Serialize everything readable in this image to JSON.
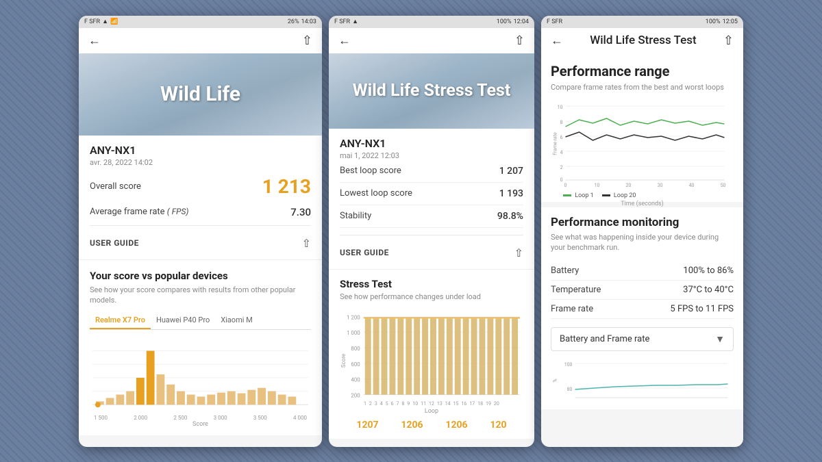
{
  "phone1": {
    "statusBar": {
      "carrier": "F SFR",
      "signal": "▲▼",
      "wifi": "▾",
      "battery": "26%",
      "time": "14:03"
    },
    "hero": {
      "title": "Wild Life"
    },
    "result": {
      "deviceName": "ANY-NX1",
      "date": "avr. 28, 2022 14:02",
      "overallScoreLabel": "Overall score",
      "overallScore": "1 213",
      "avgFrameLabel": "Average frame rate (FPS)",
      "avgFrameValue": "7.30",
      "userGuide": "USER GUIDE"
    },
    "compare": {
      "title": "Your score vs popular devices",
      "subtitle": "See how your score compares with results from other popular models.",
      "tabs": [
        "Realme X7 Pro",
        "Huawei P40 Pro",
        "Xiaomi M"
      ],
      "activeTab": 0
    },
    "xAxisLabels": [
      "1 500",
      "2 000",
      "2 500",
      "3 000",
      "3 500",
      "4 000"
    ],
    "xAxisTitle": "Score"
  },
  "phone2": {
    "statusBar": {
      "carrier": "F SFR",
      "signal": "▲▼",
      "wifi": "▾",
      "battery": "100%",
      "time": "12:04"
    },
    "hero": {
      "title": "Wild Life Stress Test"
    },
    "result": {
      "deviceName": "ANY-NX1",
      "date": "mai 1, 2022 12:03",
      "bestLoopLabel": "Best loop score",
      "bestLoopValue": "1 207",
      "lowestLoopLabel": "Lowest loop score",
      "lowestLoopValue": "1 193",
      "stabilityLabel": "Stability",
      "stabilityValue": "98.8%",
      "userGuide": "USER GUIDE"
    },
    "stress": {
      "title": "Stress Test",
      "subtitle": "See how performance changes under load",
      "yLabels": [
        "1 200",
        "1 000",
        "800",
        "600",
        "400",
        "200"
      ],
      "xLabels": [
        "1",
        "2",
        "3",
        "4",
        "5",
        "6",
        "7",
        "8",
        "9",
        "10",
        "11",
        "12",
        "13",
        "14",
        "15",
        "16",
        "17",
        "18",
        "19",
        "20"
      ],
      "yAxisTitle": "Score",
      "xAxisTitle": "Loop"
    },
    "footerScores": [
      "1207",
      "1206",
      "1206",
      "120"
    ]
  },
  "phone3": {
    "statusBar": {
      "carrier": "F SFR",
      "signal": "▲▼",
      "wifi": "▾",
      "battery": "100%",
      "time": "12:05"
    },
    "nav": {
      "title": "Wild Life Stress Test"
    },
    "perfRange": {
      "title": "Performance range",
      "subtitle": "Compare frame rates from the best and worst loops",
      "yLabels": [
        "10",
        "8",
        "6",
        "4",
        "2",
        "0"
      ],
      "xLabels": [
        "0",
        "10",
        "20",
        "30",
        "40",
        "50"
      ],
      "legend": [
        "Loop 1",
        "Loop 20"
      ],
      "yAxisTitle": "Frame rate",
      "xAxisTitle": "Time (seconds)"
    },
    "monitoring": {
      "title": "Performance monitoring",
      "subtitle": "See what was happening inside your device during your benchmark run.",
      "batteryLabel": "Battery",
      "batteryValue": "100% to 86%",
      "tempLabel": "Temperature",
      "tempValue": "37°C to 40°C",
      "frameLabel": "Frame rate",
      "frameValue": "5 FPS to 11 FPS",
      "dropdownLabel": "Battery and Frame rate",
      "yLabels": [
        "100",
        "80"
      ]
    }
  }
}
